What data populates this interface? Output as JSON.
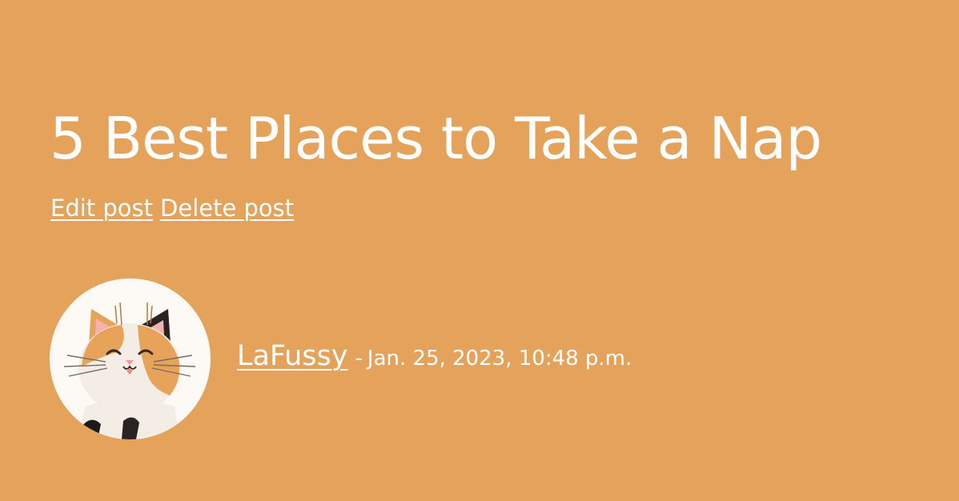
{
  "post": {
    "title": "5 Best Places to Take a Nap",
    "actions": {
      "edit_label": "Edit post",
      "delete_label": "Delete post"
    },
    "author": {
      "name": "LaFussy",
      "avatar_icon": "cat-avatar-icon"
    },
    "separator": "-",
    "timestamp": "Jan. 25, 2023, 10:48 p.m."
  },
  "colors": {
    "background": "#e4a25a",
    "text": "#ffffff"
  }
}
